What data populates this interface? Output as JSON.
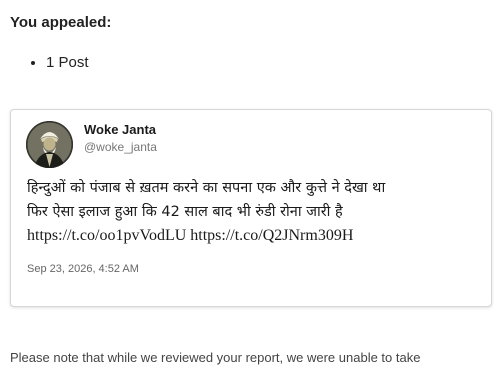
{
  "appeal": {
    "heading": "You appealed:",
    "items": [
      "1 Post"
    ]
  },
  "tweet": {
    "author_name": "Woke Janta",
    "author_handle": "@woke_janta",
    "avatar_icon": "turbaned-figure-avatar",
    "text_line_1": "हिन्दुओं को पंजाब से ख़तम करने का सपना एक और कुत्ते ने देखा था",
    "text_line_2": "फिर ऐसा इलाज हुआ कि 42 साल बाद भी रुंडी रोना जारी है",
    "link_1": "https://t.co/oo1pvVodLU",
    "link_2": "https://t.co/Q2JNrm309H",
    "date": "Sep 23, 2026, 4:52 AM"
  },
  "footer": {
    "cut_off_text": "Please note that while we reviewed your report, we were unable to take"
  }
}
